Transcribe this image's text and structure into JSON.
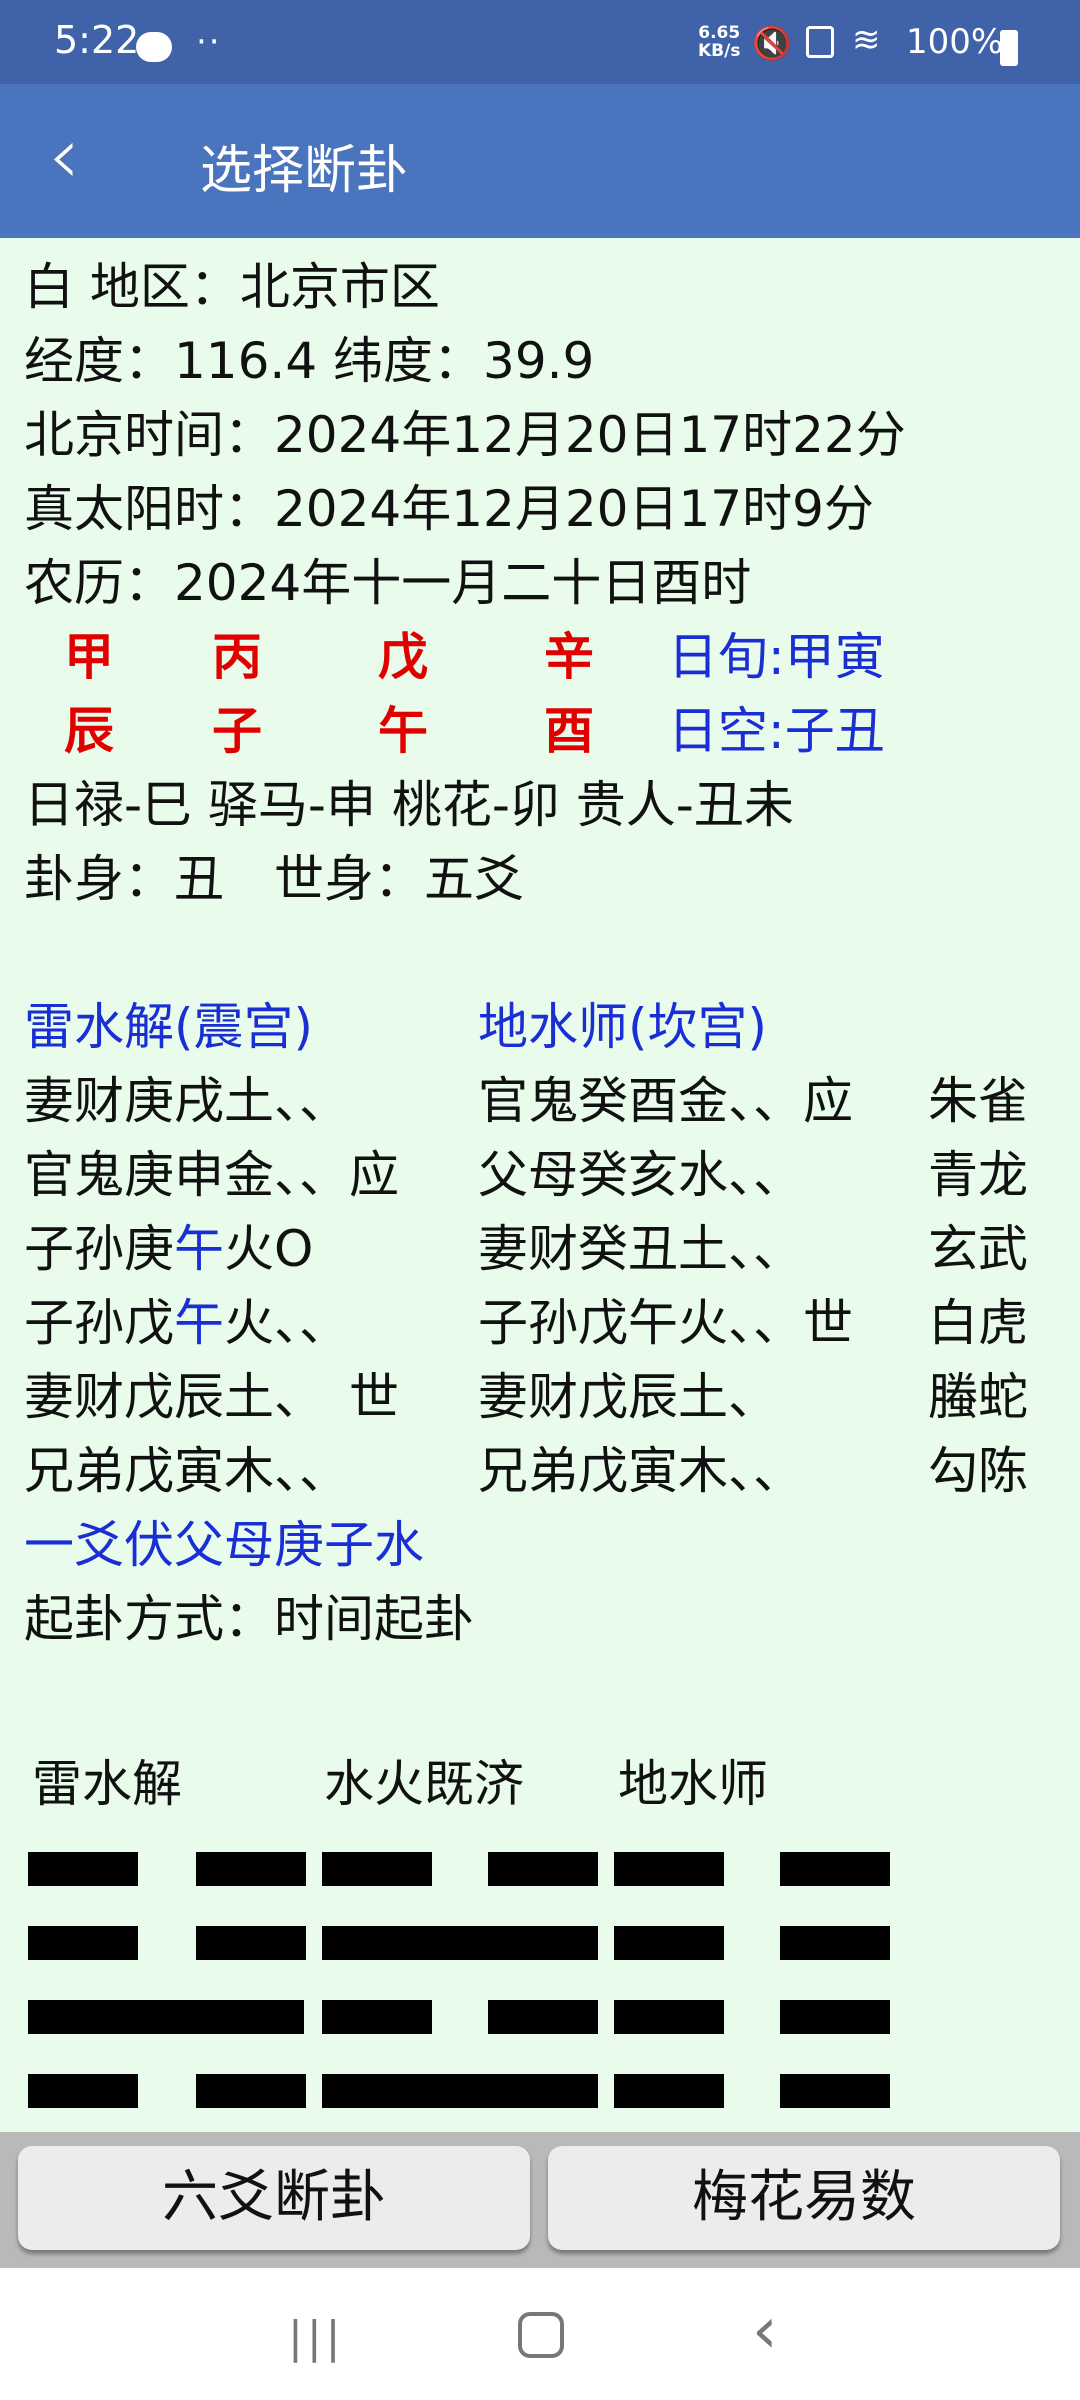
{
  "status_bar": {
    "time": "5:22",
    "dots": "··",
    "speed_top": "6.65",
    "speed_bottom": "KB/s",
    "battery": "100%"
  },
  "app_bar": {
    "title": "选择断卦",
    "back_icon": "chevron-left-icon"
  },
  "info": {
    "region": "白 地区：北京市区",
    "coords": "经度：116.4 纬度：39.9",
    "beijing_time": "北京时间：2024年12月20日17时22分",
    "solar_time": "真太阳时：2024年12月20日17时9分",
    "lunar": "农历：2024年十一月二十日酉时",
    "gan": [
      "甲",
      "丙",
      "戊",
      "辛"
    ],
    "zhi": [
      "辰",
      "子",
      "午",
      "酉"
    ],
    "xun": "日旬:甲寅",
    "kong": "日空:子丑",
    "shensha": "日禄-巳 驿马-申 桃花-卯 贵人-丑未",
    "shen": "卦身：丑　世身：五爻"
  },
  "gua": {
    "main_title": "雷水解(震宫)",
    "change_title": "地水师(坎宫)",
    "rows": [
      {
        "left_pre": "妻财庚戌土、、",
        "left_hl": "",
        "left_post": "",
        "right": "官鬼癸酉金、、应",
        "god": "朱雀"
      },
      {
        "left_pre": "官鬼庚申金、、应",
        "left_hl": "",
        "left_post": "",
        "right": "父母癸亥水、、",
        "god": "青龙"
      },
      {
        "left_pre": "子孙庚",
        "left_hl": "午",
        "left_post": "火O",
        "right": "妻财癸丑土、、",
        "god": "玄武"
      },
      {
        "left_pre": "子孙戊",
        "left_hl": "午",
        "left_post": "火、、",
        "right": "子孙戊午火、、世",
        "god": "白虎"
      },
      {
        "left_pre": "妻财戊辰土、　世",
        "left_hl": "",
        "left_post": "",
        "right": "妻财戊辰土、",
        "god": "螣蛇"
      },
      {
        "left_pre": "兄弟戊寅木、、",
        "left_hl": "",
        "left_post": "",
        "right": "兄弟戊寅木、、",
        "god": "勾陈"
      }
    ],
    "fu": "一爻伏父母庚子水",
    "method": "起卦方式：时间起卦"
  },
  "hexagrams": {
    "names": [
      "雷水解",
      "水火既济",
      "地水师"
    ]
  },
  "buttons": {
    "liuyao": "六爻断卦",
    "meihua": "梅花易数"
  },
  "colors": {
    "status": "#3f62a8",
    "appbar": "#4a74bd",
    "background": "#e9fbea",
    "red": "#e00000",
    "blue": "#1a2ed6"
  }
}
